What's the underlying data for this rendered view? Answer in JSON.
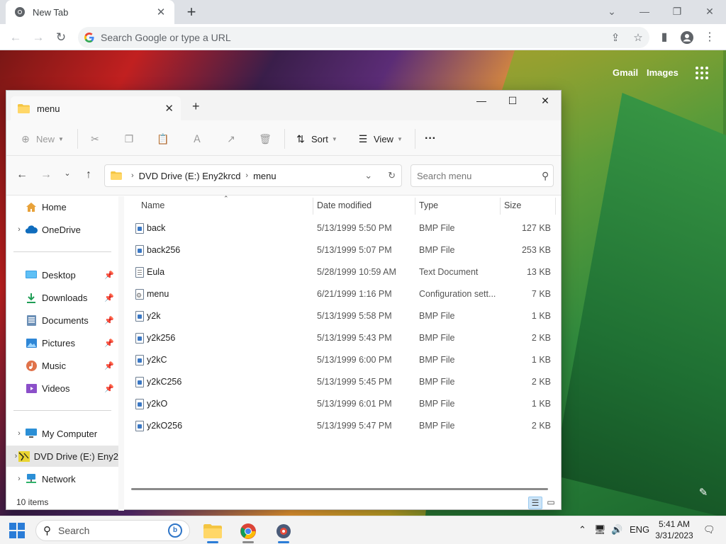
{
  "browser": {
    "tab_title": "New Tab",
    "omnibox_placeholder": "Search Google or type a URL",
    "ntp_links": [
      "Gmail",
      "Images"
    ]
  },
  "explorer": {
    "tab_title": "menu",
    "commands": {
      "new": "New",
      "sort": "Sort",
      "view": "View",
      "more": "···"
    },
    "breadcrumb": [
      "DVD Drive (E:) Eny2krcd",
      "menu"
    ],
    "search_placeholder": "Search menu",
    "nav": {
      "home": "Home",
      "onedrive": "OneDrive",
      "desktop": "Desktop",
      "downloads": "Downloads",
      "documents": "Documents",
      "pictures": "Pictures",
      "music": "Music",
      "videos": "Videos",
      "my_computer": "My Computer",
      "dvd": "DVD Drive (E:) Eny2",
      "network": "Network"
    },
    "columns": [
      "Name",
      "Date modified",
      "Type",
      "Size"
    ],
    "files": [
      {
        "name": "back",
        "date": "5/13/1999 5:50 PM",
        "type": "BMP File",
        "size": "127 KB",
        "kind": "bmp"
      },
      {
        "name": "back256",
        "date": "5/13/1999 5:07 PM",
        "type": "BMP File",
        "size": "253 KB",
        "kind": "bmp"
      },
      {
        "name": "Eula",
        "date": "5/28/1999 10:59 AM",
        "type": "Text Document",
        "size": "13 KB",
        "kind": "txt"
      },
      {
        "name": "menu",
        "date": "6/21/1999 1:16 PM",
        "type": "Configuration sett...",
        "size": "7 KB",
        "kind": "cfg"
      },
      {
        "name": "y2k",
        "date": "5/13/1999 5:58 PM",
        "type": "BMP File",
        "size": "1 KB",
        "kind": "bmp"
      },
      {
        "name": "y2k256",
        "date": "5/13/1999 5:43 PM",
        "type": "BMP File",
        "size": "2 KB",
        "kind": "bmp"
      },
      {
        "name": "y2kC",
        "date": "5/13/1999 6:00 PM",
        "type": "BMP File",
        "size": "1 KB",
        "kind": "bmp"
      },
      {
        "name": "y2kC256",
        "date": "5/13/1999 5:45 PM",
        "type": "BMP File",
        "size": "2 KB",
        "kind": "bmp"
      },
      {
        "name": "y2kO",
        "date": "5/13/1999 6:01 PM",
        "type": "BMP File",
        "size": "1 KB",
        "kind": "bmp"
      },
      {
        "name": "y2kO256",
        "date": "5/13/1999 5:47 PM",
        "type": "BMP File",
        "size": "2 KB",
        "kind": "bmp"
      }
    ],
    "status": "10 items"
  },
  "taskbar": {
    "search_label": "Search",
    "language": "ENG",
    "time": "5:41 AM",
    "date": "3/31/2023"
  },
  "colors": {
    "accent": "#2a7cd7",
    "folder": "#f4c542"
  }
}
